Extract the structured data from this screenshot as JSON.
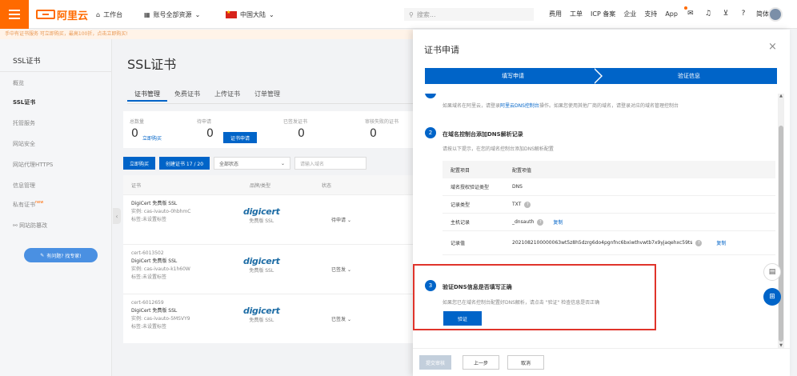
{
  "topbar": {
    "logo": "阿里云",
    "workbench": "工作台",
    "resources": "账号全部资源",
    "region": "中国大陆",
    "search_placeholder": "搜索...",
    "links": [
      "费用",
      "工单",
      "ICP 备案",
      "企业",
      "支持",
      "App"
    ],
    "language": "简体"
  },
  "notice": "手中有证书服务 可立即购买，最高100折，点击立即购买!",
  "sidebar": {
    "title": "SSL证书",
    "items": [
      "概览",
      "SSL证书",
      "托管服务",
      "网站安全",
      "网站代理HTTPS",
      "信息管理",
      "私有证书",
      "网站防篡改"
    ],
    "new_badge": "new",
    "expert_button": "有问题? 找专家!"
  },
  "main": {
    "title": "SSL证书",
    "tabs": [
      "证书管理",
      "免费证书",
      "上传证书",
      "订单管理"
    ],
    "stats": {
      "total_label": "总数量",
      "total_value": "0",
      "buy_link": "立即购买",
      "pending_label": "待申请",
      "pending_value": "0",
      "apply_button": "证书申请",
      "issued_label": "已签发证书",
      "issued_value": "0",
      "review_label": "审核失败的证书",
      "review_value": "0"
    },
    "actions": {
      "buy": "立即购买",
      "create": "创建证书 17 / 20",
      "status_select": "全部状态",
      "domain_placeholder": "请输入域名"
    },
    "table": {
      "headers": [
        "证书",
        "品牌/类型",
        "状态"
      ],
      "rows": [
        {
          "name": "",
          "type": "DigiCert 免费版 SSL",
          "instance": "实例: cas-ivauto-0hbhmC",
          "tag": "标签:未设置标签",
          "brand": "digicert",
          "brand_sub": "免费版 SSL",
          "status": "待申请"
        },
        {
          "name": "cert-6013502",
          "type": "DigiCert 免费版 SSL",
          "instance": "实例: cas-ivauto-k1h60W",
          "tag": "标签:未设置标签",
          "brand": "digicert",
          "brand_sub": "免费版 SSL",
          "status": "已签发"
        },
        {
          "name": "cert-6012659",
          "type": "DigiCert 免费版 SSL",
          "instance": "实例: cas-ivauto-5MSVY9",
          "tag": "标签:未设置标签",
          "brand": "digicert",
          "brand_sub": "免费版 SSL",
          "status": "已签发"
        }
      ]
    }
  },
  "drawer": {
    "title": "证书申请",
    "steps": [
      "填写申请",
      "验证信息"
    ],
    "section1": {
      "desc_pre": "如果域名在阿里云，请登录",
      "desc_link": "阿里云DNS控制台",
      "desc_post": "操作。如果您使用其他厂商的域名，请登录对应的域名管理控制台"
    },
    "section2": {
      "num": "2",
      "title": "在域名控制台添加DNS解析记录",
      "desc": "请按以下提示，在您的域名控制台添加DNS解析配置",
      "table_head": [
        "配置项目",
        "配置项值"
      ],
      "rows": [
        {
          "key": "域名授权验证类型",
          "value": "DNS"
        },
        {
          "key": "记录类型",
          "value": "TXT"
        },
        {
          "key": "主机记录",
          "value": "_dnsauth",
          "copy": "复制"
        },
        {
          "key": "记录值",
          "value": "2021082100000063wt5z8h5dzrg6do4pgnfnc6bxiwthvwtb7x9yjaqehxc59ts",
          "copy": "复制"
        }
      ]
    },
    "section3": {
      "num": "3",
      "title": "验证DNS信息是否填写正确",
      "desc": "如果您已在域名控制台配置好DNS解析，请点击 \"验证\" 检查信息是否正确",
      "verify": "验证"
    },
    "footer": {
      "submit": "提交审核",
      "prev": "上一步",
      "cancel": "取消"
    }
  }
}
